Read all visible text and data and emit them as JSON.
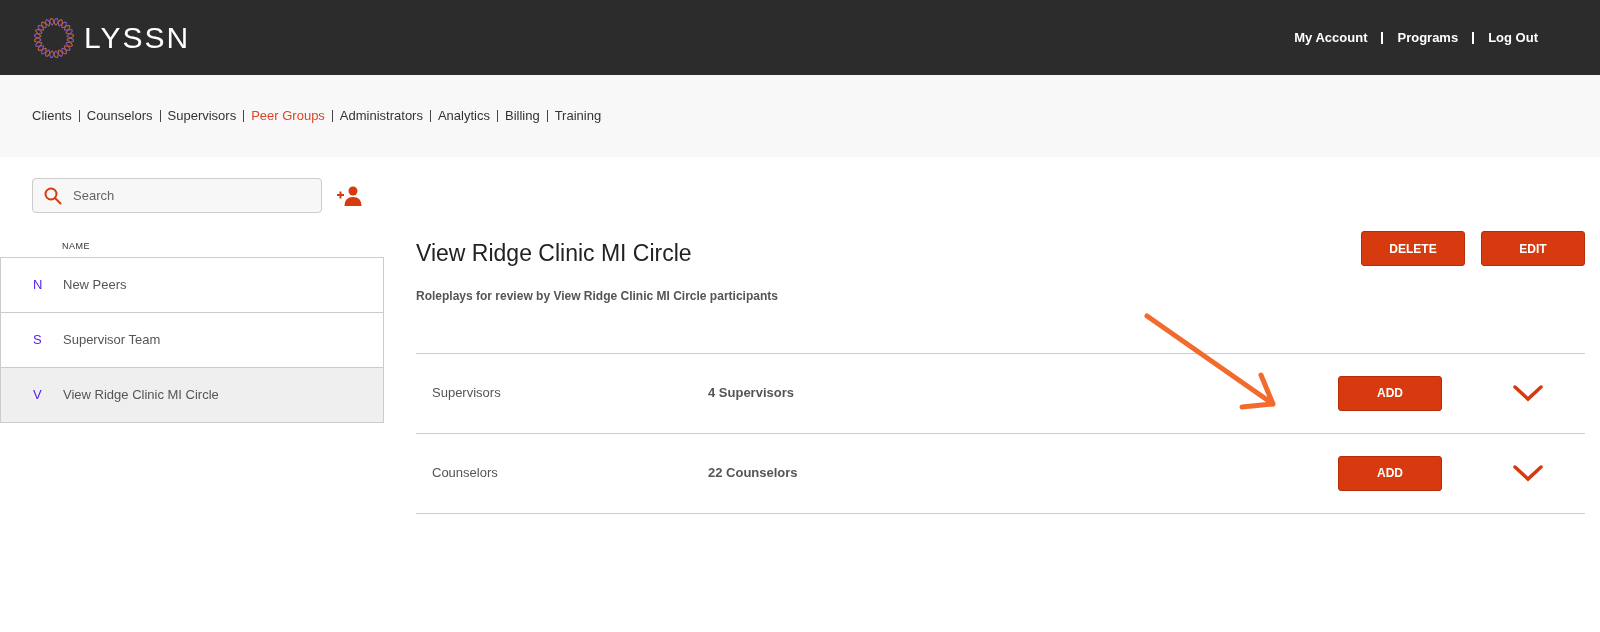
{
  "header": {
    "logo_text": "LYSSN",
    "links": [
      "My Account",
      "Programs",
      "Log Out"
    ]
  },
  "nav": [
    {
      "label": "Clients",
      "selected": false
    },
    {
      "label": "Counselors",
      "selected": false
    },
    {
      "label": "Supervisors",
      "selected": false
    },
    {
      "label": "Peer Groups",
      "selected": true
    },
    {
      "label": "Administrators",
      "selected": false
    },
    {
      "label": "Analytics",
      "selected": false
    },
    {
      "label": "Billing",
      "selected": false
    },
    {
      "label": "Training",
      "selected": false
    }
  ],
  "search": {
    "placeholder": "Search"
  },
  "list": {
    "column": "NAME",
    "items": [
      {
        "initial": "N",
        "name": "New Peers",
        "selected": false
      },
      {
        "initial": "S",
        "name": "Supervisor Team",
        "selected": false
      },
      {
        "initial": "V",
        "name": "View Ridge Clinic MI Circle",
        "selected": true
      }
    ]
  },
  "detail": {
    "title": "View Ridge Clinic MI Circle",
    "buttons": [
      "DELETE",
      "EDIT"
    ],
    "description": "Roleplays for review by View Ridge Clinic MI Circle participants",
    "sections": [
      {
        "label": "Supervisors",
        "count": "4 Supervisors",
        "button": "ADD"
      },
      {
        "label": "Counselors",
        "count": "22 Counselors",
        "button": "ADD"
      }
    ]
  }
}
